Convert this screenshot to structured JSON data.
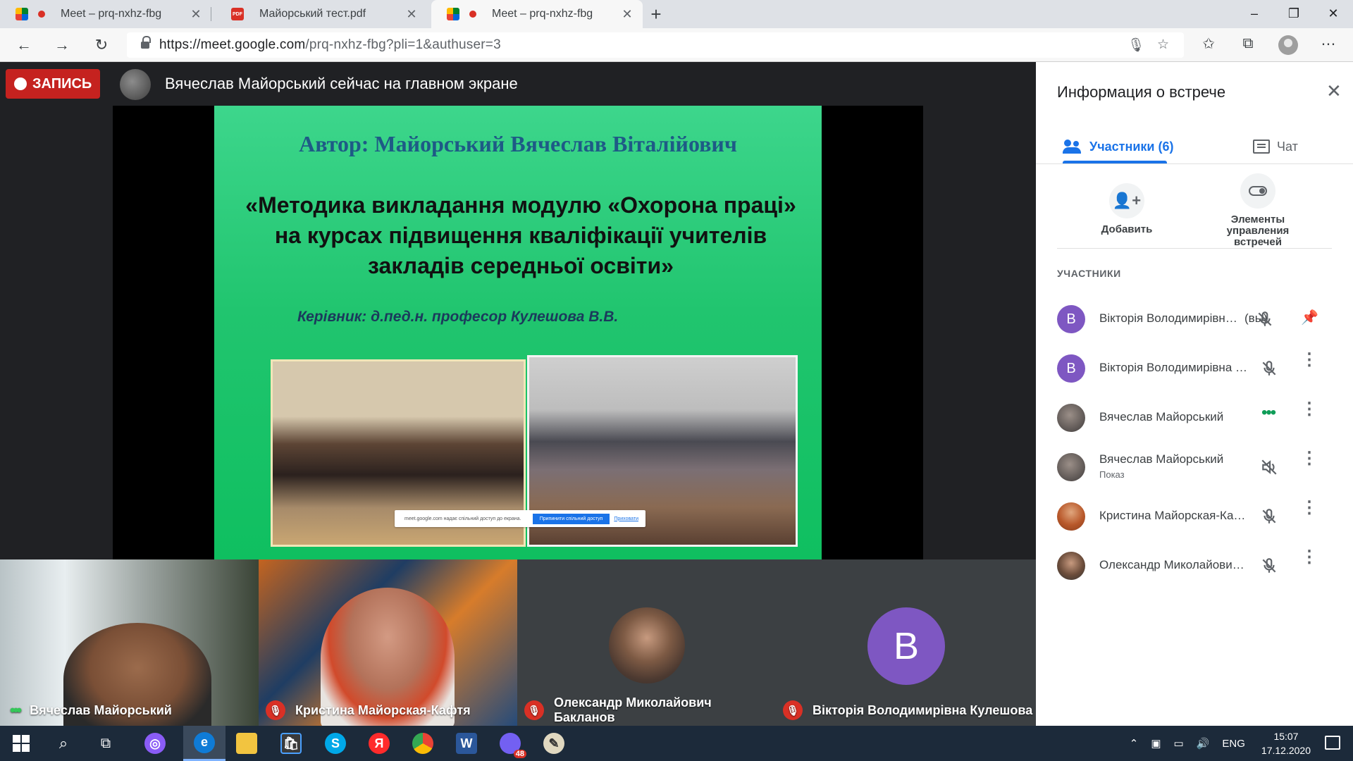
{
  "browser": {
    "tabs": [
      {
        "title": "Meet – prq-nxhz-fbg",
        "icon": "google-meet-icon",
        "recording": true,
        "active": false
      },
      {
        "title": "Майорський тест.pdf",
        "icon": "pdf-icon",
        "recording": false,
        "active": false
      },
      {
        "title": "Meet – prq-nxhz-fbg",
        "icon": "google-meet-icon",
        "recording": true,
        "active": true
      }
    ],
    "new_tab_symbol": "+",
    "url_main": "https://meet.google.com",
    "url_rest": "/prq-nxhz-fbg?pli=1&authuser=3",
    "window_controls": {
      "minimize": "–",
      "maximize": "❐",
      "close": "✕"
    }
  },
  "meet": {
    "recording_label": "ЗАПИСЬ",
    "presenter_message": "Вячеслав Майорський сейчас на главном экране",
    "slide": {
      "author": "Автор: Майорський Вячеслав Віталійович",
      "title_line1": "«Методика викладання модулю «Охорона праці»",
      "title_line2": "на курсах підвищення кваліфікації учителів",
      "title_line3": "закладів середньої освіти»",
      "lead": "Керівник: д.пед.н. професор Кулешова В.В.",
      "share_bar_text": "meet.google.com надає спільний доступ до екрана.",
      "share_bar_stop": "Припинити спільний доступ",
      "share_bar_hide": "Приховати"
    },
    "tiles": [
      {
        "name": "Вячеслав Майорський",
        "muted": false,
        "speaking": true
      },
      {
        "name": "Кристина Майорская-Кафтя",
        "muted": true
      },
      {
        "name": "Олександр Миколайович Бакланов",
        "muted": true
      },
      {
        "name": "Вікторія Володимирівна Кулешова",
        "muted": true,
        "avatar_letter": "B"
      }
    ]
  },
  "panel": {
    "title": "Информация о встрече",
    "tab_people": "Участники (6)",
    "tab_chat": "Чат",
    "action_add": "Добавить",
    "action_controls_line1": "Элементы",
    "action_controls_line2": "управления",
    "action_controls_line3": "встречей",
    "section_heading": "УЧАСТНИКИ",
    "participants": [
      {
        "name": "Вікторія Володимирівна Кулешова",
        "badge": "(вы)",
        "avatar_letter": "B",
        "muted": true
      },
      {
        "name": "Вікторія Володимирівна Кулешова",
        "avatar_letter": "B",
        "muted": true
      },
      {
        "name": "Вячеслав Майорський",
        "speaking": true
      },
      {
        "name": "Вячеслав Майорський",
        "subtitle": "Показ",
        "audio_off": true
      },
      {
        "name": "Кристина Майорская-Кафтя",
        "muted": true
      },
      {
        "name": "Олександр Миколайович Бакланов",
        "muted": true
      }
    ]
  },
  "taskbar": {
    "language": "ENG",
    "time": "15:07",
    "date": "17.12.2020",
    "viber_badge": "48"
  },
  "colors": {
    "accent": "#1a73e8",
    "record_red": "#c5221f",
    "slide_green": "#21c56f",
    "avatar_purple": "#7e57c2"
  }
}
